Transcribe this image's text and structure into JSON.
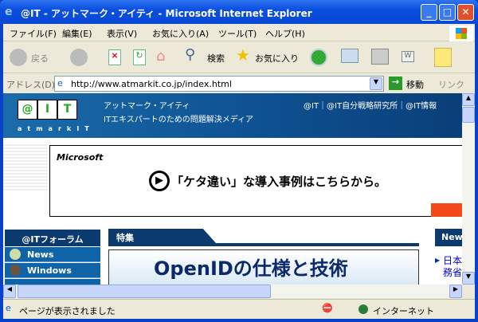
{
  "window": {
    "title": "@IT - アットマーク・アイティ - Microsoft Internet Explorer"
  },
  "menu": [
    "ファイル(F)",
    "編集(E)",
    "表示(V)",
    "お気に入り(A)",
    "ツール(T)",
    "ヘルプ(H)"
  ],
  "toolbar": {
    "back": "戻る",
    "search": "検索",
    "favorites": "お気に入り"
  },
  "address": {
    "label": "アドレス(D)",
    "url": "http://www.atmarkit.co.jp/index.html",
    "go": "移動",
    "links": "リンク"
  },
  "page": {
    "logo": {
      "letters": [
        "@",
        "I",
        "T"
      ],
      "sub": "atmarkIT"
    },
    "site_name": "アットマーク・アイティ",
    "tagline": "ITエキスパートのための問題解決メディア",
    "top_links": "@IT｜@IT自分戦略研究所｜@IT情報",
    "ad": {
      "brand": "Microsoft",
      "text": "「ケタ違い」な導入事例はこちらから。"
    },
    "forum_title": "@ITフォーラム",
    "nav": [
      "News",
      "Windows"
    ],
    "feature_title": "特集",
    "feature_image_text": "OpenIDの仕様と技術",
    "news_title": "New",
    "news_items": [
      "日本",
      "務省"
    ]
  },
  "status": {
    "text": "ページが表示されました",
    "zone": "インターネット"
  }
}
